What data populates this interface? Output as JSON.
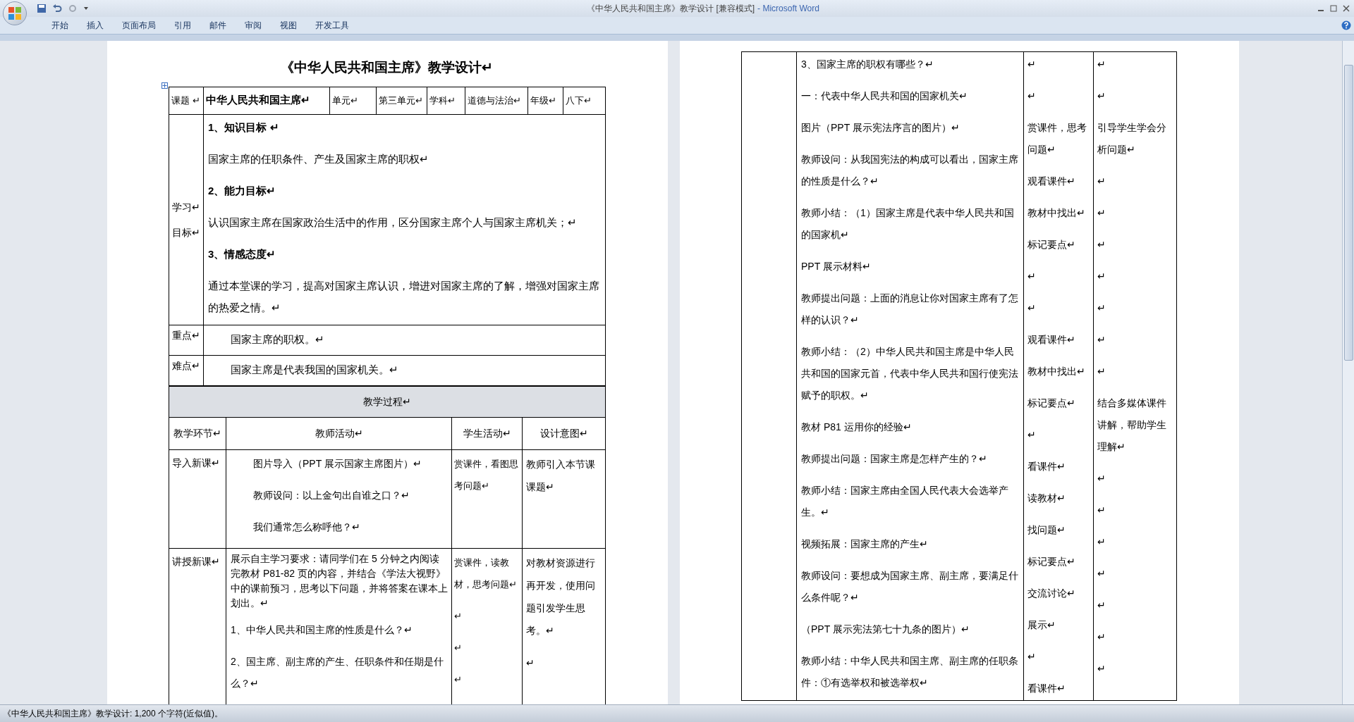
{
  "window": {
    "title": "《中华人民共和国主席》教学设计 [兼容模式]",
    "app_name": "- Microsoft Word"
  },
  "ribbon_tabs": [
    {
      "label": "开始"
    },
    {
      "label": "插入"
    },
    {
      "label": "页面布局"
    },
    {
      "label": "引用"
    },
    {
      "label": "邮件"
    },
    {
      "label": "审阅"
    },
    {
      "label": "视图"
    },
    {
      "label": "开发工具"
    }
  ],
  "left_page": {
    "doc_title": "《中华人民共和国主席》教学设计↵",
    "info_cells": [
      {
        "text": "课题 ↵",
        "bold": false
      },
      {
        "text": "中华人民共和国主席↵",
        "bold": true
      },
      {
        "text": "单元↵",
        "bold": false
      },
      {
        "text": "第三单元↵",
        "bold": false
      },
      {
        "text": "学科↵",
        "bold": false
      },
      {
        "text": "道德与法治↵",
        "bold": false
      },
      {
        "text": "年级↵",
        "bold": false
      },
      {
        "text": "八下↵",
        "bold": false
      }
    ],
    "goals": {
      "label": [
        "学习↵",
        "目标↵"
      ],
      "paragraphs": [
        {
          "text": "1、知识目标  ↵",
          "bold": true
        },
        {
          "text": "国家主席的任职条件、产生及国家主席的职权↵",
          "bold": false
        },
        {
          "text": "2、能力目标↵",
          "bold": true
        },
        {
          "text": "认识国家主席在国家政治生活中的作用，区分国家主席个人与国家主席机关；↵",
          "bold": false
        },
        {
          "text": "3、情感态度↵",
          "bold": true
        },
        {
          "text": "通过本堂课的学习，提高对国家主席认识，增进对国家主席的了解，增强对国家主席的热爱之情。↵",
          "bold": false
        }
      ]
    },
    "points": [
      {
        "label": "重点↵",
        "text": "国家主席的职权。↵"
      },
      {
        "label": "难点↵",
        "text": "国家主席是代表我国的国家机关。↵"
      }
    ],
    "process": {
      "title": "教学过程↵",
      "columns": [
        "教学环节↵",
        "教师活动↵",
        "学生活动↵",
        "设计意图↵"
      ],
      "rows": [
        {
          "stage": "导入新课↵",
          "indented": true,
          "teacher": [
            "图片导入（PPT 展示国家主席图片）↵",
            "教师设问：以上金句出自谁之口？↵",
            "我们通常怎么称呼他？↵"
          ],
          "student": [
            "赏课件，看图思考问题↵"
          ],
          "intent": [
            "教师引入本节课课题↵"
          ]
        },
        {
          "stage": "讲授新课↵",
          "indented": false,
          "teacher": [
            "展示自主学习要求：请同学们在 5 分钟之内阅读完教材 P81-82 页的内容，并结合《学法大视野》中的课前预习，思考以下问题，并将答案在课本上划出。↵",
            "1、中华人民共和国主席的性质是什么？↵",
            "2、国主席、副主席的产生、任职条件和任期是什么？↵"
          ],
          "student": [
            "赏课件，读教材，思考问题↵",
            "↵",
            "↵",
            "↵"
          ],
          "intent": [
            "对教材资源进行再开发，使用问题引发学生思考。↵",
            "↵"
          ]
        }
      ]
    }
  },
  "right_page": {
    "teacher": [
      "3、国家主席的职权有哪些？↵",
      "一：代表中华人民共和国的国家机关↵",
      "图片（PPT 展示宪法序言的图片）↵",
      "教师设问：从我国宪法的构成可以看出，国家主席的性质是什么？↵",
      "教师小结：（1）国家主席是代表中华人民共和国的国家机↵",
      "PPT 展示材料↵",
      "教师提出问题：上面的消息让你对国家主席有了怎样的认识？↵",
      "教师小结：（2）中华人民共和国主席是中华人民共和国的国家元首，代表中华人民共和国行使宪法赋予的职权。↵",
      "教材 P81 运用你的经验↵",
      "教师提出问题：国家主席是怎样产生的？↵",
      "教师小结：国家主席由全国人民代表大会选举产生。↵",
      "视频拓展：国家主席的产生↵",
      "教师设问：要想成为国家主席、副主席，要满足什么条件呢？↵",
      "（PPT 展示宪法第七十九条的图片）↵",
      "教师小结：中华人民共和国主席、副主席的任职条件：①有选举权和被选举权↵"
    ],
    "student": [
      "↵",
      "↵",
      "赏课件，思考问题↵",
      "观看课件↵",
      "教材中找出↵",
      "标记要点↵",
      "↵",
      "↵",
      "观看课件↵",
      "教材中找出↵",
      "标记要点↵",
      "↵",
      "看课件↵",
      "读教材↵",
      "找问题↵",
      "标记要点↵",
      "交流讨论↵",
      "展示↵",
      "↵",
      "看课件↵"
    ],
    "intent": [
      "↵",
      "↵",
      "引导学生学会分析问题↵",
      "↵",
      "↵",
      "↵",
      "↵",
      "↵",
      "↵",
      "↵",
      "结合多媒体课件讲解，帮助学生理解↵",
      "↵",
      "↵",
      "↵",
      "↵",
      "↵",
      "↵",
      "↵"
    ]
  },
  "status_bar": {
    "text": "《中华人民共和国主席》教学设计: 1,200 个字符(近似值)。"
  }
}
